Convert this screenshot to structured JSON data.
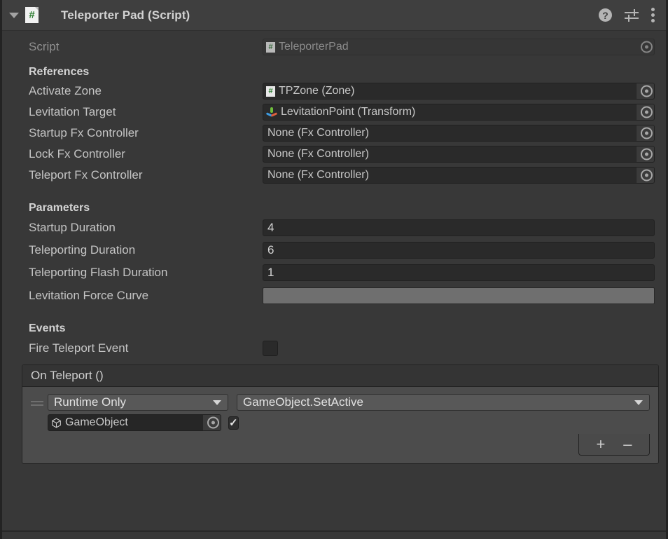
{
  "component": {
    "title": "Teleporter Pad (Script)",
    "icon": "csharp-script-icon",
    "foldout_expanded": true,
    "header_icons": {
      "help": "?",
      "preset": "preset-icon",
      "menu": "kebab-menu-icon"
    }
  },
  "script_row": {
    "label": "Script",
    "value": "TeleporterPad",
    "icon": "csharp-script-icon",
    "disabled": true
  },
  "sections": {
    "references": {
      "heading": "References",
      "fields": [
        {
          "label": "Activate Zone",
          "value": "TPZone (Zone)",
          "icon": "csharp-script-icon"
        },
        {
          "label": "Levitation Target",
          "value": "LevitationPoint (Transform)",
          "icon": "transform-icon"
        },
        {
          "label": "Startup Fx Controller",
          "value": "None (Fx Controller)",
          "icon": "none"
        },
        {
          "label": "Lock Fx Controller",
          "value": "None (Fx Controller)",
          "icon": "none"
        },
        {
          "label": "Teleport Fx Controller",
          "value": "None (Fx Controller)",
          "icon": "none"
        }
      ]
    },
    "parameters": {
      "heading": "Parameters",
      "fields": [
        {
          "label": "Startup Duration",
          "value": "4",
          "type": "number"
        },
        {
          "label": "Teleporting Duration",
          "value": "6",
          "type": "number"
        },
        {
          "label": "Teleporting Flash Duration",
          "value": "1",
          "type": "number"
        },
        {
          "label": "Levitation Force Curve",
          "value": "",
          "type": "curve"
        }
      ]
    },
    "events": {
      "heading": "Events",
      "toggle": {
        "label": "Fire Teleport Event",
        "checked": false
      },
      "unity_event": {
        "title": "On Teleport ()",
        "entries": [
          {
            "call_state": "Runtime Only",
            "method": "GameObject.SetActive",
            "target_object": "GameObject",
            "argument_checked": true
          }
        ],
        "add_label": "+",
        "remove_label": "–"
      }
    }
  },
  "colors": {
    "panel_bg": "#383838",
    "header_bg": "#3f3f3f",
    "field_bg": "#2a2a2a",
    "event_bg": "#4c4c4c",
    "event_header_bg": "#343434",
    "dropdown_bg": "#585858",
    "curve_bg": "#6f6f6f",
    "text": "#c4c4c4",
    "script_green": "#2e7d32"
  }
}
